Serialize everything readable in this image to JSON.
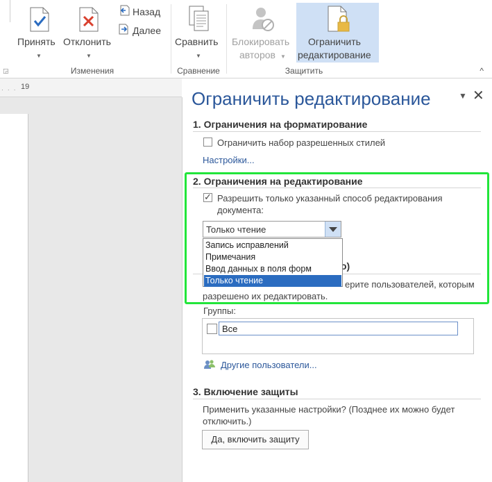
{
  "ribbon": {
    "buttons": {
      "accept": "Принять",
      "reject": "Отклонить",
      "previous": "Назад",
      "next": "Далее",
      "compare": "Сравнить",
      "block_authors_line1": "Блокировать",
      "block_authors_line2": "авторов",
      "restrict_line1": "Ограничить",
      "restrict_line2": "редактирование"
    },
    "groups": {
      "changes": "Изменения",
      "compare": "Сравнение",
      "protect": "Защитить"
    },
    "collapse_glyph": "^"
  },
  "ruler": {
    "number": "19"
  },
  "pane": {
    "title": "Ограничить редактирование",
    "menu_glyph": "▼",
    "close_glyph": "✕",
    "section1": {
      "title": "1. Ограничения на форматирование",
      "checkbox_label": "Ограничить набор разрешенных стилей",
      "checked": false,
      "settings_link": "Настройки..."
    },
    "section2": {
      "title": "2. Ограничения на редактирование",
      "checkbox_label_line1": "Разрешить только указанный способ редактирования",
      "checkbox_label_line2": "документа:",
      "checked": true,
      "select_value": "Только чтение",
      "options": [
        "Запись исправлений",
        "Примечания",
        "Ввод данных в поля форм",
        "Только чтение"
      ],
      "selected_index": 3,
      "exceptions_heading_tail": "о)",
      "exceptions_text_tail": "ерите пользователей, которым",
      "exceptions_text_line2": "разрешено их редактировать.",
      "groups_label": "Группы:",
      "everyone_label": "Все",
      "other_users_link": "Другие пользователи..."
    },
    "section3": {
      "title": "3. Включение защиты",
      "text_line1": "Применить указанные настройки? (Позднее их можно будет",
      "text_line2": "отключить.)",
      "enable_button": "Да, включить защиту"
    }
  },
  "colors": {
    "accent": "#2b579a",
    "highlight_border": "#22e53a",
    "selected_option": "#2b6cc0",
    "active_ribbon_button": "#cfe0f5"
  }
}
